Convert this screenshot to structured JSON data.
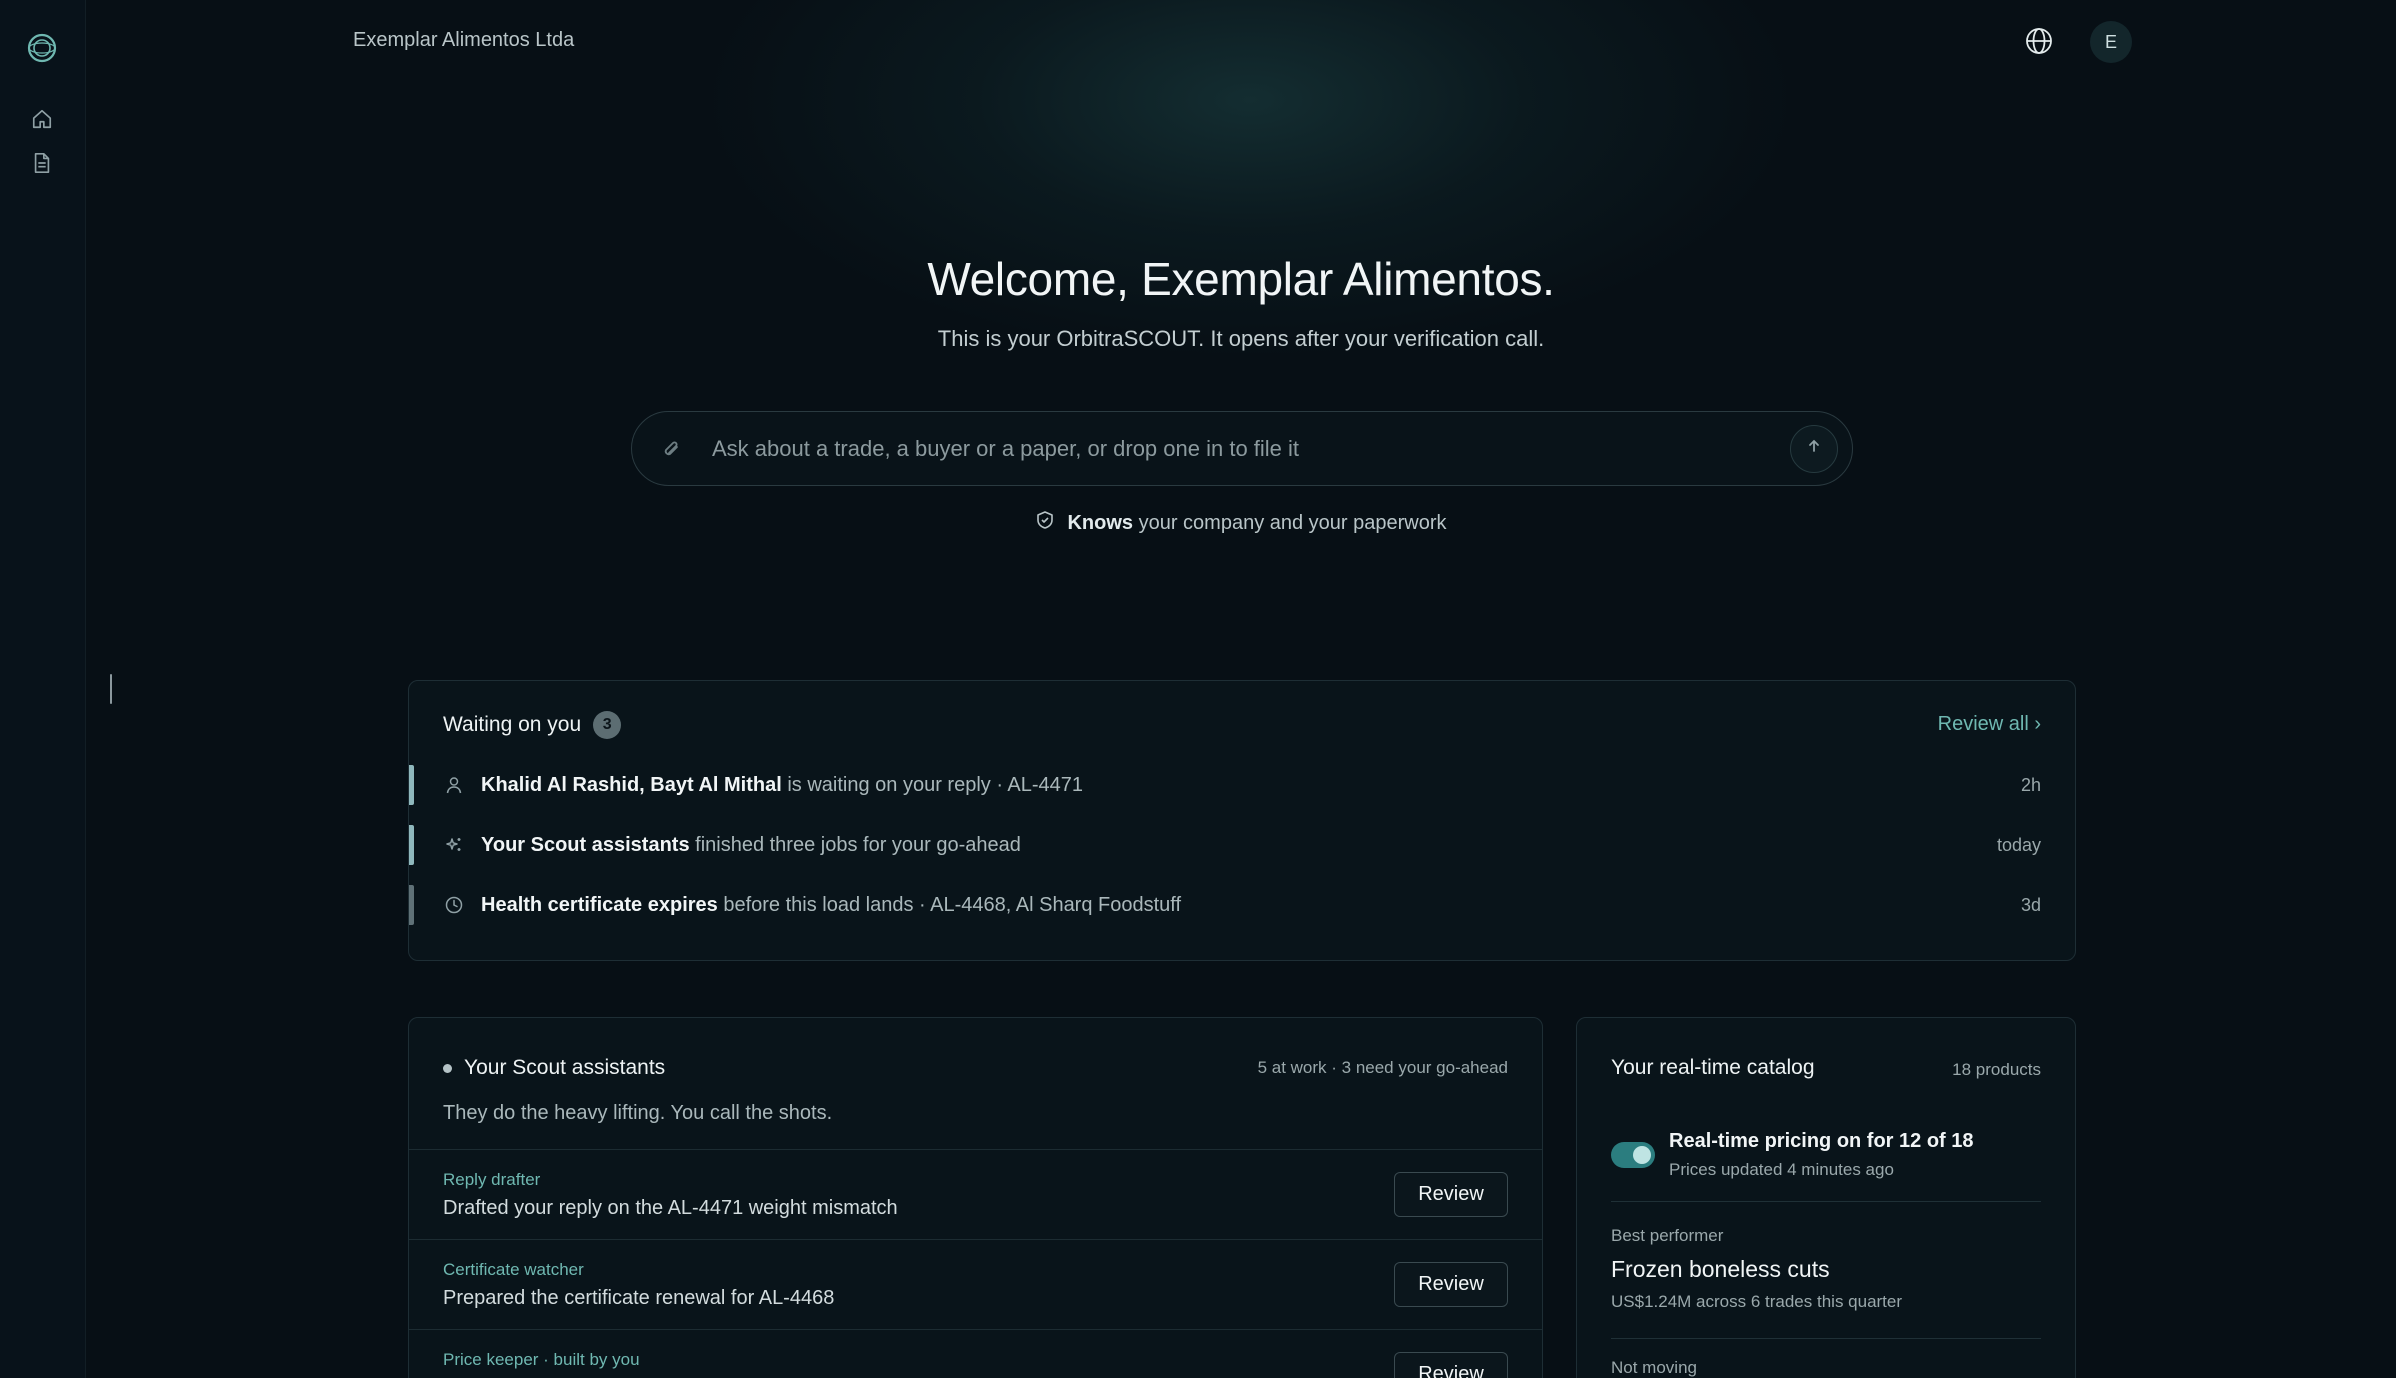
{
  "app": {
    "company_name": "Exemplar Alimentos Ltda",
    "avatar_initial": "E"
  },
  "hero": {
    "title": "Welcome, Exemplar Alimentos.",
    "subtitle": "This is your OrbitraSCOUT. It opens after your verification call.",
    "ask_placeholder": "Ask about a trade, a buyer or a paper, or drop one in to file it",
    "knows_bold": "Knows",
    "knows_rest": "your company and your paperwork"
  },
  "waiting": {
    "title": "Waiting on you",
    "count": "3",
    "review_all": "Review all ›",
    "items": [
      {
        "icon": "person-icon",
        "bold": "Khalid Al Rashid, Bayt Al Mithal",
        "rest": " is waiting on your reply · AL-4471",
        "time": "2h"
      },
      {
        "icon": "sparkle-icon",
        "bold": "Your Scout assistants",
        "rest": " finished three jobs for your go-ahead",
        "time": "today"
      },
      {
        "icon": "clock-icon",
        "bold": "Health certificate expires",
        "rest": " before this load lands · AL-4468, Al Sharq Foodstuff",
        "time": "3d"
      }
    ]
  },
  "assistants": {
    "title": "Your Scout assistants",
    "meta": "5 at work · 3 need your go-ahead",
    "subtitle": "They do the heavy lifting. You call the shots.",
    "jobs": [
      {
        "role": "Reply drafter",
        "desc": "Drafted your reply on the AL-4471 weight mismatch",
        "button": "Review"
      },
      {
        "role": "Certificate watcher",
        "desc": "Prepared the certificate renewal for AL-4468",
        "button": "Review"
      },
      {
        "role": "Price keeper · built by you",
        "desc": "",
        "button": "Review"
      }
    ]
  },
  "catalog": {
    "title": "Your real-time catalog",
    "count": "18 products",
    "realtime_title": "Real-time pricing on for 12 of 18",
    "realtime_sub": "Prices updated 4 minutes ago",
    "best_label": "Best performer",
    "best_name": "Frozen boneless cuts",
    "best_sub": "US$1.24M across 6 trades this quarter",
    "not_moving_label": "Not moving"
  },
  "colors": {
    "background": "#070f15",
    "accent": "#6fb8b1",
    "toggle_on": "#2b7d7f"
  }
}
